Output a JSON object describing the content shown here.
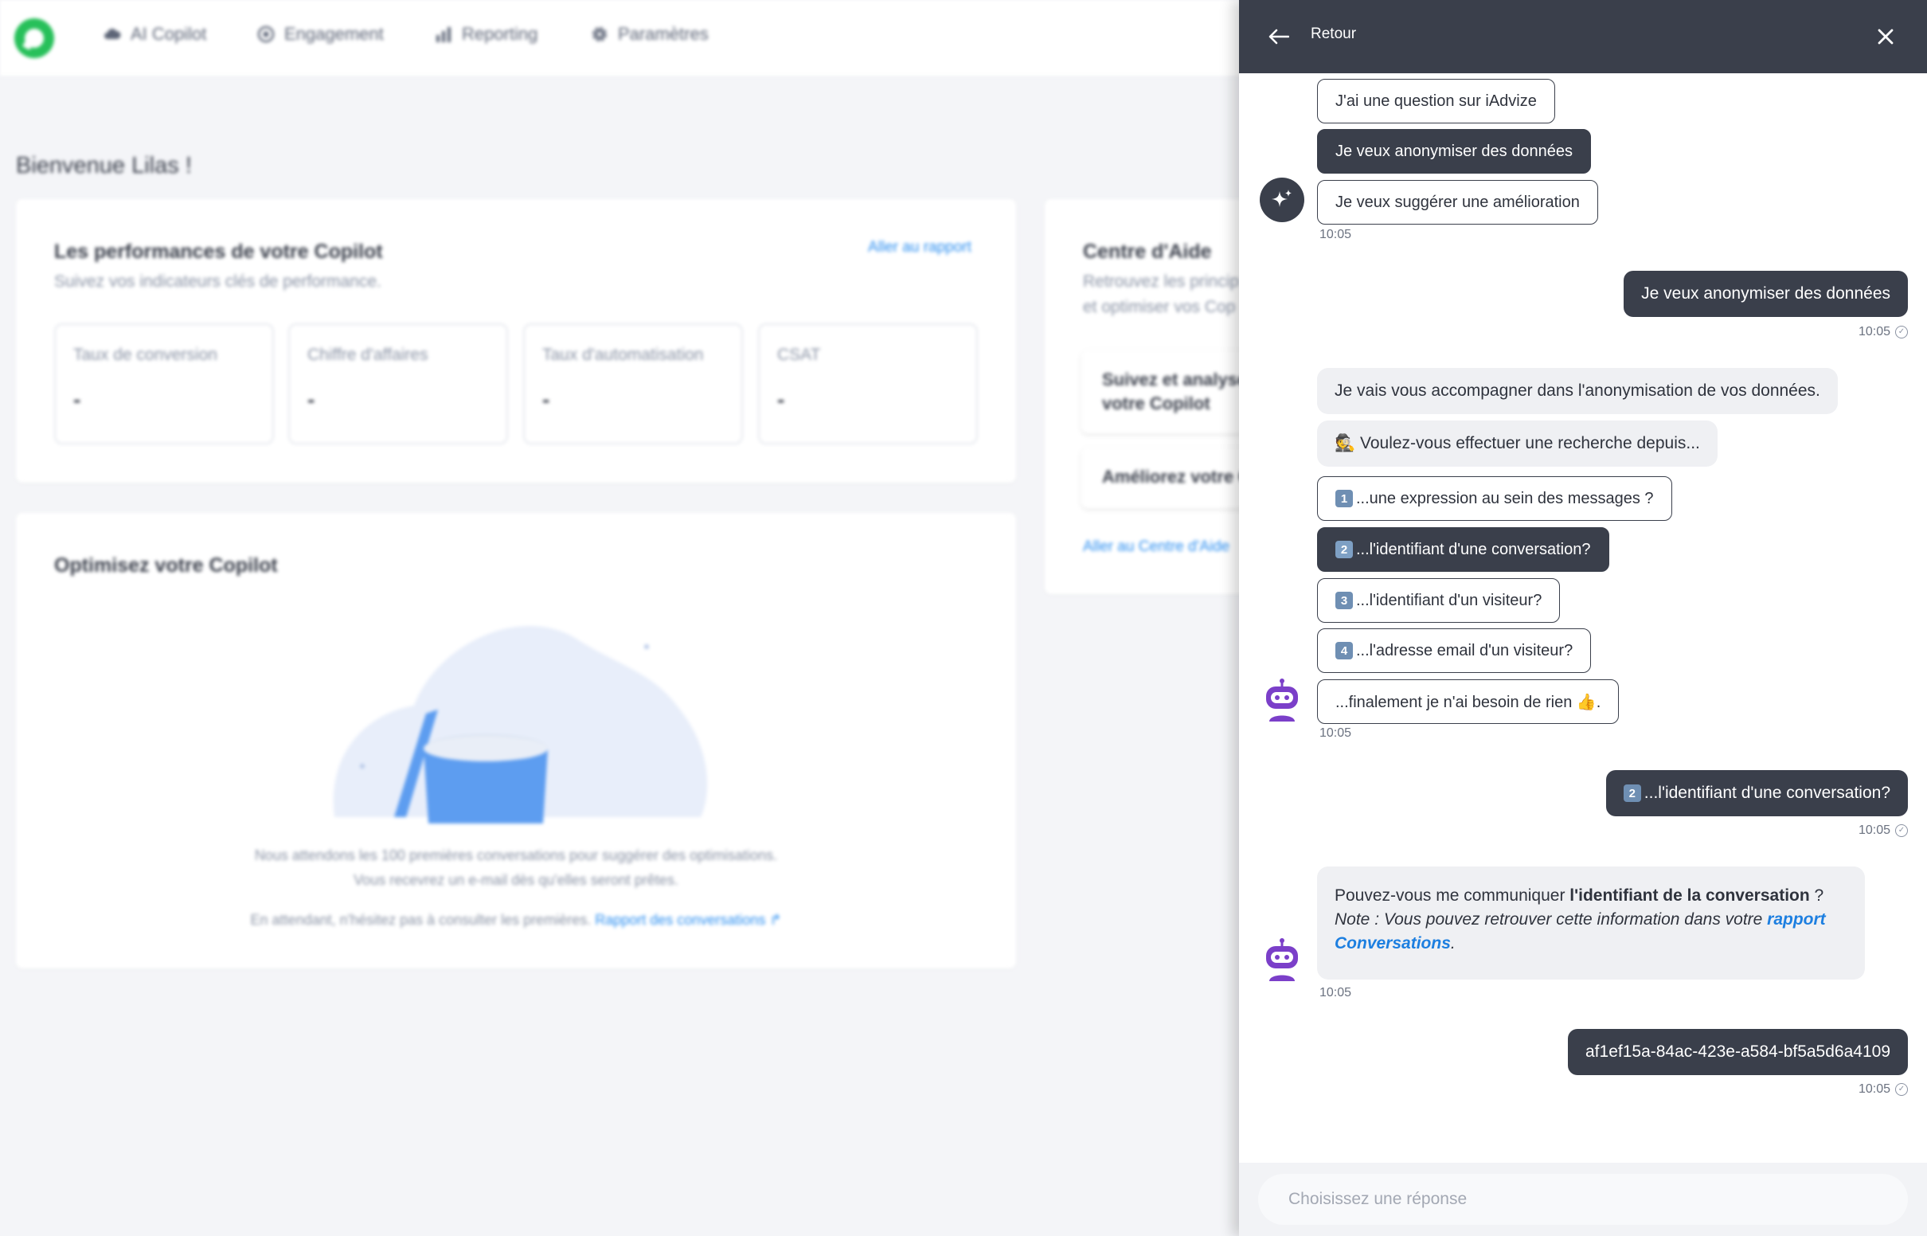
{
  "nav": {
    "items": [
      {
        "label": "AI Copilot",
        "icon": "cloud-icon"
      },
      {
        "label": "Engagement",
        "icon": "target-icon"
      },
      {
        "label": "Reporting",
        "icon": "bar-chart-icon"
      },
      {
        "label": "Paramètres",
        "icon": "gear-icon"
      }
    ]
  },
  "dashboard": {
    "welcome": "Bienvenue Lilas !",
    "performance": {
      "title": "Les performances de votre Copilot",
      "subtitle": "Suivez vos indicateurs clés de performance.",
      "report_link": "Aller au rapport",
      "kpis": [
        {
          "label": "Taux de conversion",
          "value": "-"
        },
        {
          "label": "Chiffre d'affaires",
          "value": "-"
        },
        {
          "label": "Taux d'automatisation",
          "value": "-"
        },
        {
          "label": "CSAT",
          "value": "-"
        }
      ]
    },
    "help": {
      "title": "Centre d'Aide",
      "subtitle_line1": "Retrouvez les princip",
      "subtitle_line2": "et optimiser vos Cop",
      "item1_line1": "Suivez et analyse",
      "item1_line2": "votre Copilot",
      "item2": "Améliorez votre C",
      "link": "Aller au Centre d'Aide"
    },
    "optimize": {
      "title": "Optimisez votre Copilot",
      "text_line1": "Nous attendons les 100 premières conversations pour suggérer des optimisations.",
      "text_line2": "Vous recevrez un e-mail dès qu'elles seront prêtes.",
      "text_line3": "En attendant, n'hésitez pas à consulter les premières.",
      "link": "Rapport des conversations"
    }
  },
  "chat": {
    "header": {
      "back_label": "Retour"
    },
    "group1": {
      "chips": [
        {
          "label": "J'ai une question sur iAdvize",
          "selected": false
        },
        {
          "label": "Je veux anonymiser des données",
          "selected": true
        },
        {
          "label": "Je veux suggérer une amélioration",
          "selected": false
        }
      ],
      "time": "10:05"
    },
    "user1": {
      "text": "Je veux anonymiser des données",
      "time": "10:05"
    },
    "bot2": {
      "intro": "Je vais vous accompagner dans l'anonymisation de vos données.",
      "question": "🕵️ Voulez-vous effectuer une recherche depuis...",
      "chips": [
        {
          "num": "1",
          "label": "...une expression au sein des messages ?",
          "selected": false
        },
        {
          "num": "2",
          "label": "...l'identifiant d'une conversation?",
          "selected": true
        },
        {
          "num": "3",
          "label": "...l'identifiant d'un visiteur?",
          "selected": false
        },
        {
          "num": "4",
          "label": "...l'adresse email d'un visiteur?",
          "selected": false
        },
        {
          "num": "",
          "label": "...finalement je n'ai besoin de rien 👍.",
          "selected": false
        }
      ],
      "time": "10:05"
    },
    "user2": {
      "num": "2",
      "text": "...l'identifiant d'une conversation?",
      "time": "10:05"
    },
    "bot3": {
      "line1_prefix": "Pouvez-vous me communiquer ",
      "line1_bold": "l'identifiant de la conversation",
      "line1_suffix": " ?",
      "note_prefix": "Note : Vous pouvez retrouver cette information dans votre ",
      "note_link_part1": "rapport",
      "note_link_part2": "Conversations",
      "note_suffix": ".",
      "time": "10:05"
    },
    "user3": {
      "text": "af1ef15a-84ac-423e-a584-bf5a5d6a4109",
      "time": "10:05"
    },
    "footer": {
      "placeholder": "Choisissez une réponse"
    }
  }
}
